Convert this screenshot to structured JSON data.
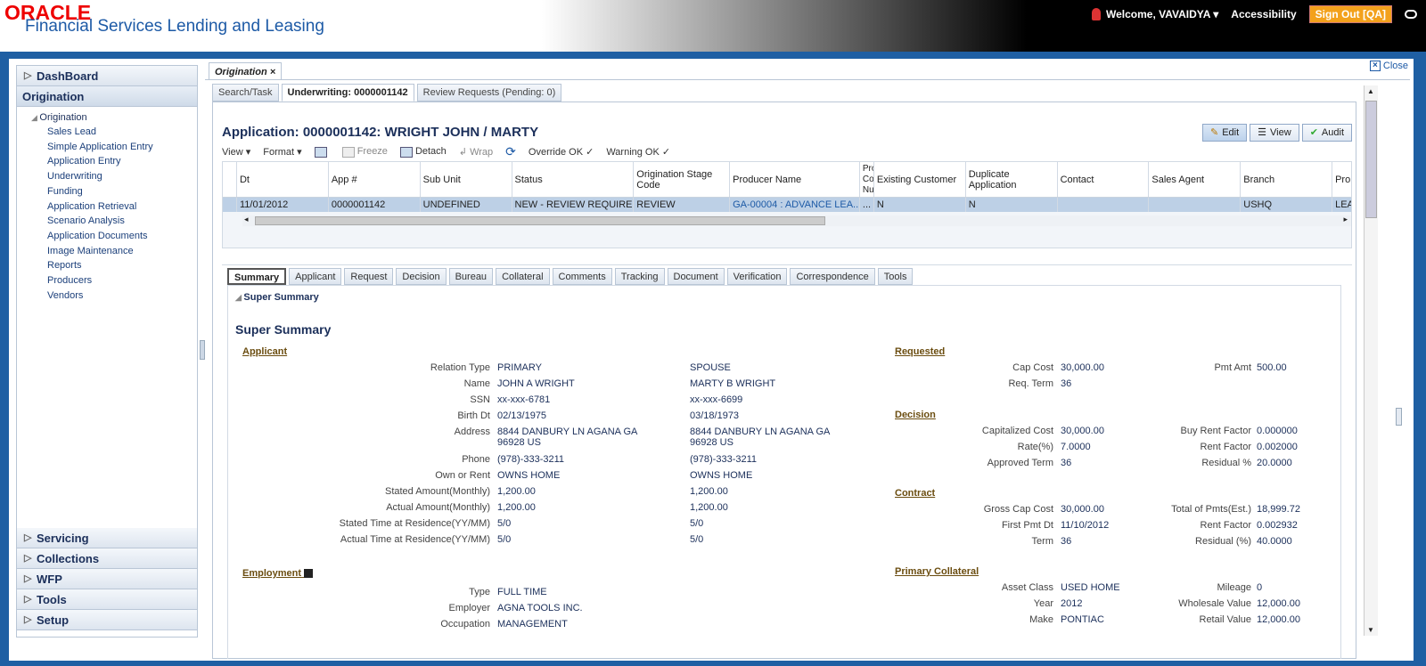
{
  "header": {
    "logo": "ORACLE",
    "product": "Financial Services Lending and Leasing",
    "welcome": "Welcome, VAVAIDYA",
    "accessibility": "Accessibility",
    "signout": "Sign Out [QA]"
  },
  "sidebar": {
    "top": [
      "DashBoard",
      "Origination"
    ],
    "tree_root": "Origination",
    "items": [
      "Sales Lead",
      "Simple Application Entry",
      "Application Entry",
      "Underwriting",
      "Funding",
      "Application Retrieval",
      "Scenario Analysis",
      "Application Documents",
      "Image Maintenance",
      "Reports",
      "Producers",
      "Vendors"
    ],
    "bottom": [
      "Servicing",
      "Collections",
      "WFP",
      "Tools",
      "Setup"
    ]
  },
  "page_tab": "Origination",
  "close_label": "Close",
  "subtabs": [
    "Search/Task",
    "Underwriting: 0000001142",
    "Review Requests (Pending: 0)"
  ],
  "app_title": "Application: 0000001142: WRIGHT JOHN / MARTY",
  "actions": {
    "edit": "Edit",
    "view": "View",
    "audit": "Audit"
  },
  "toolbar": {
    "view": "View",
    "format": "Format",
    "freeze": "Freeze",
    "detach": "Detach",
    "wrap": "Wrap",
    "override": "Override OK",
    "warning": "Warning OK"
  },
  "grid": {
    "columns": [
      "Dt",
      "App #",
      "Sub Unit",
      "Status",
      "Origination Stage Code",
      "Producer Name",
      "Pro Co Nu",
      "Existing Customer",
      "Duplicate Application",
      "Contact",
      "Sales Agent",
      "Branch",
      "Pro"
    ],
    "row": [
      "11/01/2012",
      "0000001142",
      "UNDEFINED",
      "NEW - REVIEW REQUIRED",
      "REVIEW",
      "GA-00004 : ADVANCE LEA...",
      "...",
      "N",
      "N",
      "",
      "",
      "USHQ",
      "LEA"
    ]
  },
  "content_tabs": [
    "Summary",
    "Applicant",
    "Request",
    "Decision",
    "Bureau",
    "Collateral",
    "Comments",
    "Tracking",
    "Document",
    "Verification",
    "Correspondence",
    "Tools"
  ],
  "summary": {
    "section_label": "Super Summary",
    "title": "Super Summary",
    "applicant_head": "Applicant",
    "applicant": [
      {
        "label": "Relation Type",
        "a": "PRIMARY",
        "b": "SPOUSE"
      },
      {
        "label": "Name",
        "a": "JOHN A WRIGHT",
        "b": "MARTY B WRIGHT"
      },
      {
        "label": "SSN",
        "a": "xx-xxx-6781",
        "b": "xx-xxx-6699"
      },
      {
        "label": "Birth Dt",
        "a": "02/13/1975",
        "b": "03/18/1973"
      },
      {
        "label": "Address",
        "a": "8844 DANBURY LN AGANA GA",
        "a2": "96928 US",
        "b": "8844 DANBURY LN AGANA GA",
        "b2": "96928 US"
      },
      {
        "label": "Phone",
        "a": "(978)-333-3211",
        "b": "(978)-333-3211"
      },
      {
        "label": "Own or Rent",
        "a": "OWNS HOME",
        "b": "OWNS HOME"
      },
      {
        "label": "Stated Amount(Monthly)",
        "a": "1,200.00",
        "b": "1,200.00"
      },
      {
        "label": "Actual Amount(Monthly)",
        "a": "1,200.00",
        "b": "1,200.00"
      },
      {
        "label": "Stated Time at Residence(YY/MM)",
        "a": "5/0",
        "b": "5/0"
      },
      {
        "label": "Actual Time at Residence(YY/MM)",
        "a": "5/0",
        "b": "5/0"
      }
    ],
    "employment_head": "Employment",
    "employment": [
      {
        "label": "Type",
        "a": "FULL TIME"
      },
      {
        "label": "Employer",
        "a": "AGNA TOOLS INC."
      },
      {
        "label": "Occupation",
        "a": "MANAGEMENT"
      }
    ],
    "requested_head": "Requested",
    "requested": [
      {
        "l1": "Cap Cost",
        "v1": "30,000.00",
        "l2": "Pmt Amt",
        "v2": "500.00"
      },
      {
        "l1": "Req. Term",
        "v1": "36",
        "l2": "",
        "v2": ""
      }
    ],
    "decision_head": "Decision",
    "decision": [
      {
        "l1": "Capitalized Cost",
        "v1": "30,000.00",
        "l2": "Buy Rent Factor",
        "v2": "0.000000"
      },
      {
        "l1": "Rate(%)",
        "v1": "7.0000",
        "l2": "Rent Factor",
        "v2": "0.002000"
      },
      {
        "l1": "Approved Term",
        "v1": "36",
        "l2": "Residual %",
        "v2": "20.0000"
      }
    ],
    "contract_head": "Contract",
    "contract": [
      {
        "l1": "Gross Cap Cost",
        "v1": "30,000.00",
        "l2": "Total of Pmts(Est.)",
        "v2": "18,999.72"
      },
      {
        "l1": "First Pmt Dt",
        "v1": "11/10/2012",
        "l2": "Rent Factor",
        "v2": "0.002932"
      },
      {
        "l1": "Term",
        "v1": "36",
        "l2": "Residual (%)",
        "v2": "40.0000"
      }
    ],
    "collateral_head": "Primary Collateral",
    "collateral": [
      {
        "l1": "Asset Class",
        "v1": "USED HOME",
        "l2": "Mileage",
        "v2": "0"
      },
      {
        "l1": "Year",
        "v1": "2012",
        "l2": "Wholesale Value",
        "v2": "12,000.00"
      },
      {
        "l1": "Make",
        "v1": "PONTIAC",
        "l2": "Retail Value",
        "v2": "12,000.00"
      }
    ]
  }
}
